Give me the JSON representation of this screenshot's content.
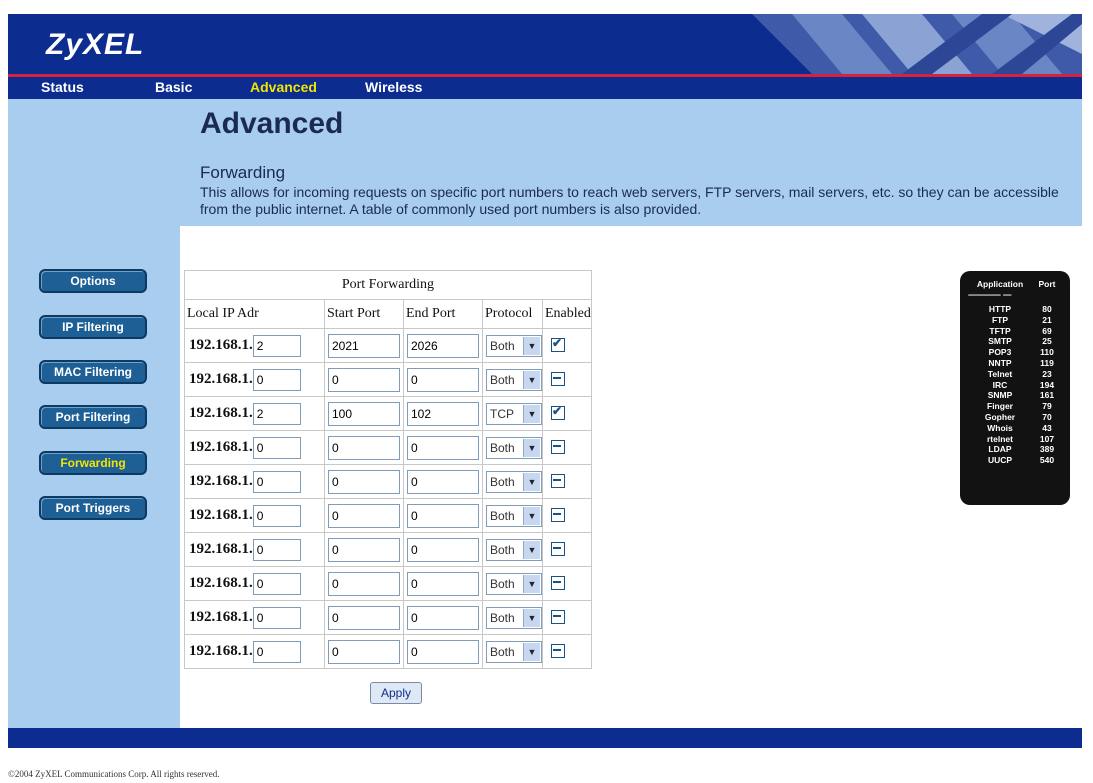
{
  "brand": {
    "logo": "ZyXEL"
  },
  "nav": [
    {
      "label": "Status",
      "active": false
    },
    {
      "label": "Basic",
      "active": false
    },
    {
      "label": "Advanced",
      "active": true
    },
    {
      "label": "Wireless",
      "active": false
    }
  ],
  "intro": {
    "page_title": "Advanced",
    "section_title": "Forwarding",
    "section_desc": "This allows for incoming requests on specific port numbers to reach  web servers, FTP servers, mail servers, etc. so they can be accessible from the public internet.  A table of commonly used port numbers is also provided."
  },
  "sidebar": [
    {
      "label": "Options",
      "active": false
    },
    {
      "label": "IP Filtering",
      "active": false
    },
    {
      "label": "MAC Filtering",
      "active": false
    },
    {
      "label": "Port Filtering",
      "active": false
    },
    {
      "label": "Forwarding",
      "active": true
    },
    {
      "label": "Port Triggers",
      "active": false
    }
  ],
  "table": {
    "caption": "Port Forwarding",
    "headers": [
      "Local IP Adr",
      "Start Port",
      "End Port",
      "Protocol",
      "Enabled"
    ],
    "ip_prefix": "192.168.1.",
    "rows": [
      {
        "ip": "2",
        "start": "2021",
        "end": "2026",
        "protocol": "Both",
        "enabled": true
      },
      {
        "ip": "0",
        "start": "0",
        "end": "0",
        "protocol": "Both",
        "enabled": false
      },
      {
        "ip": "2",
        "start": "100",
        "end": "102",
        "protocol": "TCP",
        "enabled": true
      },
      {
        "ip": "0",
        "start": "0",
        "end": "0",
        "protocol": "Both",
        "enabled": false
      },
      {
        "ip": "0",
        "start": "0",
        "end": "0",
        "protocol": "Both",
        "enabled": false
      },
      {
        "ip": "0",
        "start": "0",
        "end": "0",
        "protocol": "Both",
        "enabled": false
      },
      {
        "ip": "0",
        "start": "0",
        "end": "0",
        "protocol": "Both",
        "enabled": false
      },
      {
        "ip": "0",
        "start": "0",
        "end": "0",
        "protocol": "Both",
        "enabled": false
      },
      {
        "ip": "0",
        "start": "0",
        "end": "0",
        "protocol": "Both",
        "enabled": false
      },
      {
        "ip": "0",
        "start": "0",
        "end": "0",
        "protocol": "Both",
        "enabled": false
      }
    ]
  },
  "apply_label": "Apply",
  "legend": {
    "header_app": "Application",
    "header_port": "Port",
    "rows": [
      {
        "app": "HTTP",
        "port": "80"
      },
      {
        "app": "FTP",
        "port": "21"
      },
      {
        "app": "TFTP",
        "port": "69"
      },
      {
        "app": "SMTP",
        "port": "25"
      },
      {
        "app": "POP3",
        "port": "110"
      },
      {
        "app": "NNTP",
        "port": "119"
      },
      {
        "app": "Telnet",
        "port": "23"
      },
      {
        "app": "IRC",
        "port": "194"
      },
      {
        "app": "SNMP",
        "port": "161"
      },
      {
        "app": "Finger",
        "port": "79"
      },
      {
        "app": "Gopher",
        "port": "70"
      },
      {
        "app": "Whois",
        "port": "43"
      },
      {
        "app": "rtelnet",
        "port": "107"
      },
      {
        "app": "LDAP",
        "port": "389"
      },
      {
        "app": "UUCP",
        "port": "540"
      }
    ]
  },
  "footer": {
    "copyright": "©2004 ZyXEL Communications Corp.  All rights reserved."
  },
  "colors": {
    "header_blue": "#0d2c8f",
    "accent_red": "#d8213b",
    "light_blue": "#a9cdee",
    "active_yellow": "#f2e600",
    "button_blue": "#1e5f96"
  }
}
